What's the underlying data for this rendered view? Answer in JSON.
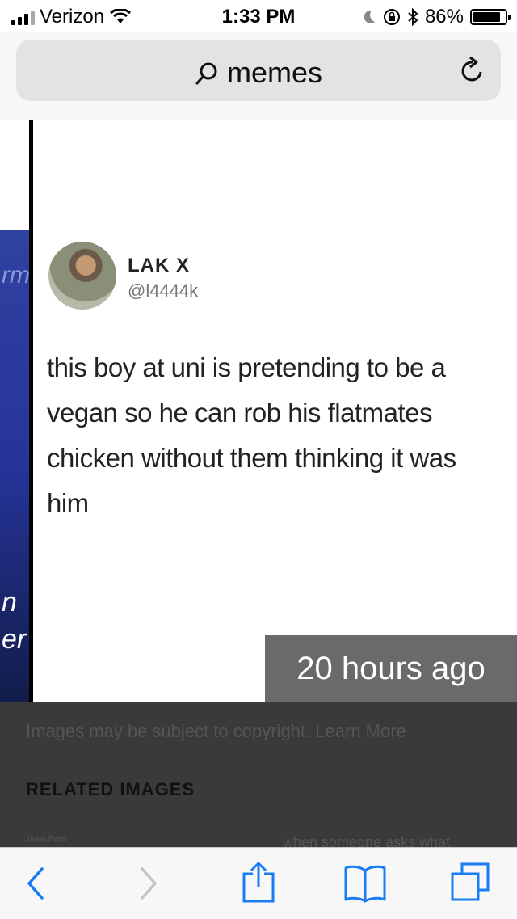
{
  "status": {
    "carrier": "Verizon",
    "time": "1:33 PM",
    "battery": "86%",
    "battery_level": 0.86
  },
  "urlbar": {
    "query": "memes"
  },
  "tweet": {
    "name": "LAK X",
    "handle": "@l4444k",
    "lines": [
      "this boy at uni is pretending to be a",
      "vegan so he can rob his flatmates",
      "chicken without them thinking it was",
      "him"
    ]
  },
  "left_fragments": [
    "rm",
    "n",
    "er"
  ],
  "image_meta": {
    "time_ago": "20 hours ago"
  },
  "footer": {
    "copyright": "Images may be subject to copyright. Learn More",
    "related": "RELATED IMAGES",
    "thumb1_caption": "Jordan Peele",
    "thumb2_caption": "when someone asks what"
  },
  "toolbar_icons": [
    "back-icon",
    "forward-icon",
    "share-icon",
    "bookmarks-icon",
    "tabs-icon"
  ]
}
